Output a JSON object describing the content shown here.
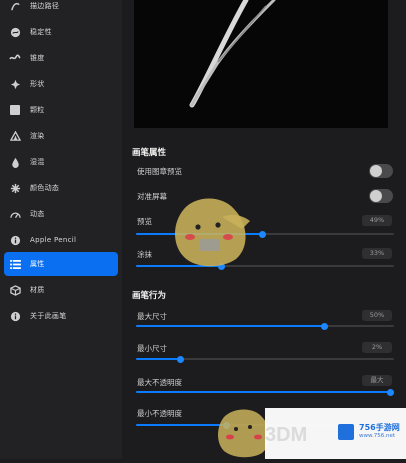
{
  "sidebar": {
    "items": [
      {
        "label": "描边路径",
        "icon": "stroke-path-icon",
        "active": false
      },
      {
        "label": "稳定性",
        "icon": "stabilization-icon",
        "active": false
      },
      {
        "label": "锥度",
        "icon": "taper-icon",
        "active": false
      },
      {
        "label": "形状",
        "icon": "shape-icon",
        "active": false
      },
      {
        "label": "颗粒",
        "icon": "grain-icon",
        "active": false
      },
      {
        "label": "渲染",
        "icon": "rendering-icon",
        "active": false
      },
      {
        "label": "湿混",
        "icon": "wet-mix-icon",
        "active": false
      },
      {
        "label": "颜色动态",
        "icon": "color-dynamics-icon",
        "active": false
      },
      {
        "label": "动态",
        "icon": "dynamics-icon",
        "active": false
      },
      {
        "label": "Apple Pencil",
        "icon": "apple-pencil-icon",
        "active": false
      },
      {
        "label": "属性",
        "icon": "properties-icon",
        "active": true
      },
      {
        "label": "材质",
        "icon": "materials-icon",
        "active": false
      },
      {
        "label": "关于此画笔",
        "icon": "about-brush-icon",
        "active": false
      }
    ]
  },
  "brush_properties": {
    "title": "画笔属性",
    "stamp_preview_label": "使用图章预览",
    "stamp_preview_on": false,
    "orient_to_screen_label": "对准屏幕",
    "orient_to_screen_on": false,
    "preview_label": "预览",
    "preview_value": "49%",
    "preview_level": 0.49,
    "smudge_label": "涂抹",
    "smudge_value": "33%",
    "smudge_level": 0.33
  },
  "brush_behavior": {
    "title": "画笔行为",
    "max_size_label": "最大尺寸",
    "max_size_value": "50%",
    "max_size_level": 0.73,
    "min_size_label": "最小尺寸",
    "min_size_value": "2%",
    "min_size_level": 0.17,
    "max_opacity_label": "最大不透明度",
    "max_opacity_value": "最大",
    "max_opacity_level": 1.0,
    "min_opacity_label": "最小不透明度",
    "min_opacity_level": 0.35
  },
  "watermark": {
    "site": "756手游网",
    "brand": "3DM",
    "url": "www.756.net"
  },
  "colors": {
    "accent": "#0a7aff",
    "active_bg": "#0a6ff0",
    "panel_bg": "#1c1c1e",
    "sidebar_bg": "#222224"
  }
}
